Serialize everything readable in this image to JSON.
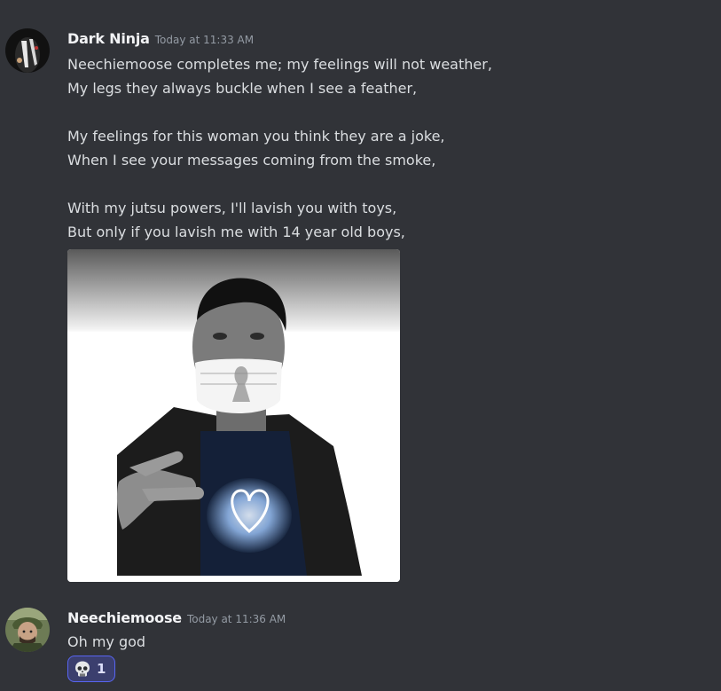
{
  "messages": [
    {
      "username": "Dark Ninja",
      "timestamp": "Today at 11:33 AM",
      "lines": [
        "Neechiemoose completes me; my feelings will not weather,",
        "My legs they always buckle when I see a feather,",
        "",
        "My feelings for this woman you think they are a joke,",
        "When I see your messages coming from the smoke,",
        "",
        "With my jutsu powers, I'll lavish you with toys,",
        "But only if you lavish me with 14 year old boys,"
      ]
    },
    {
      "username": "Neechiemoose",
      "timestamp": "Today at 11:36 AM",
      "text": "Oh my god",
      "reaction": {
        "icon": "skull-icon",
        "count": "1"
      }
    }
  ],
  "colors": {
    "background": "#313338",
    "username": "#f2f3f5",
    "timestamp": "#949ba4",
    "text": "#dbdee1",
    "reaction_border": "#5865f2",
    "reaction_bg": "#3b3f6e"
  }
}
